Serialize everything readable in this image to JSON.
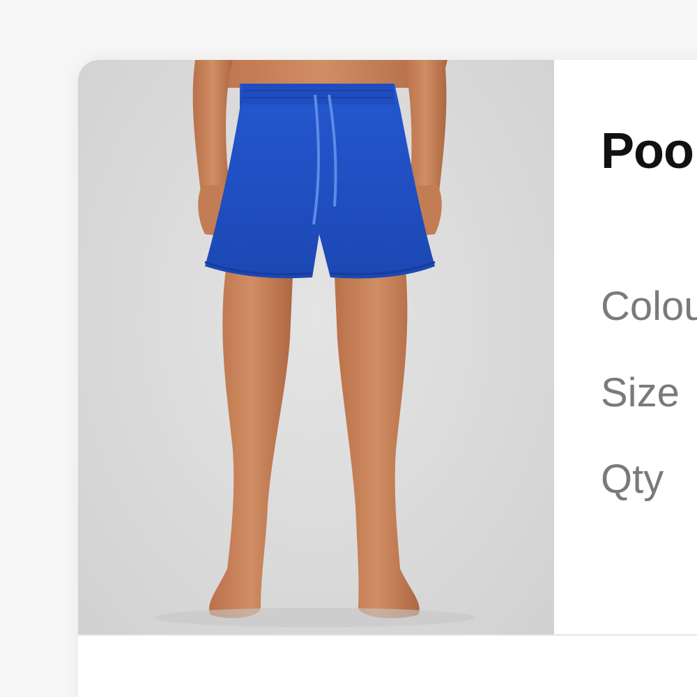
{
  "product": {
    "title": "Poo",
    "image_alt": "blue-drawstring-shorts-photo"
  },
  "attributes": {
    "colour_label": "Colou",
    "size_label": "Size",
    "qty_label": "Qty"
  },
  "colors": {
    "shorts_blue": "#1f4fc4",
    "background": "#f6f6f6",
    "card": "#ffffff",
    "label_gray": "#7a7a7a",
    "title_black": "#111111"
  }
}
